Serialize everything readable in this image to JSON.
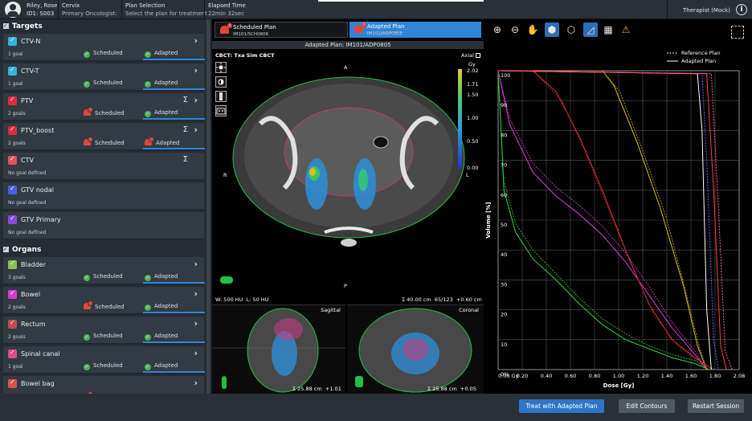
{
  "header": {
    "patient_name": "Riley, Rose",
    "id_label": "ID1:",
    "id_value": "S003",
    "site": "Cervix",
    "oncologist_label": "Primary Oncologist:",
    "plan_selection_label": "Plan Selection",
    "plan_selection_value": "Select the plan for treatment",
    "elapsed_label": "Elapsed Time",
    "elapsed_value": "22min 32sec",
    "role": "Therapist (Mock)",
    "info_icon": "info-icon"
  },
  "targets": {
    "title": "Targets",
    "items": [
      {
        "name": "CTV-N",
        "goals": "1 goal",
        "color": "#33b5e5",
        "scheduled": "Scheduled",
        "adapted": "Adapted",
        "sched_alert": false,
        "adapt_alert": false,
        "sigma": false,
        "chevron": true
      },
      {
        "name": "CTV-T",
        "goals": "1 goal",
        "color": "#33b5e5",
        "scheduled": "Scheduled",
        "adapted": "Adapted",
        "sched_alert": false,
        "adapt_alert": false,
        "sigma": false,
        "chevron": true
      },
      {
        "name": "PTV",
        "goals": "2 goals",
        "color": "#e02b3c",
        "scheduled": "Scheduled",
        "adapted": "Adapted",
        "sched_alert": true,
        "adapt_alert": false,
        "sigma": true,
        "chevron": true
      },
      {
        "name": "PTV_boost",
        "goals": "2 goals",
        "color": "#e02b3c",
        "scheduled": "Scheduled",
        "adapted": "Adapted",
        "sched_alert": true,
        "adapt_alert": true,
        "sigma": true,
        "chevron": true
      },
      {
        "name": "CTV",
        "goals": "No goal defined",
        "color": "#e85060",
        "scheduled": "",
        "adapted": "",
        "sched_alert": false,
        "adapt_alert": false,
        "sigma": true,
        "chevron": false
      },
      {
        "name": "GTV nodal",
        "goals": "No goal defined",
        "color": "#4b5fe0",
        "scheduled": "",
        "adapted": "",
        "sched_alert": false,
        "adapt_alert": false,
        "sigma": false,
        "chevron": false
      },
      {
        "name": "GTV Primary",
        "goals": "No goal defined",
        "color": "#8a4be0",
        "scheduled": "",
        "adapted": "",
        "sched_alert": false,
        "adapt_alert": false,
        "sigma": false,
        "chevron": false
      }
    ]
  },
  "organs": {
    "title": "Organs",
    "items": [
      {
        "name": "Bladder",
        "goals": "3 goals",
        "color": "#8bc34a",
        "scheduled": "Scheduled",
        "adapted": "Adapted",
        "sched_alert": false,
        "adapt_alert": false,
        "sigma": false,
        "chevron": true
      },
      {
        "name": "Bowel",
        "goals": "2 goals",
        "color": "#d63ad6",
        "scheduled": "Scheduled",
        "adapted": "Adapted",
        "sched_alert": true,
        "adapt_alert": false,
        "sigma": false,
        "chevron": true
      },
      {
        "name": "Rectum",
        "goals": "2 goals",
        "color": "#c0504d",
        "scheduled": "Scheduled",
        "adapted": "Adapted",
        "sched_alert": false,
        "adapt_alert": false,
        "sigma": false,
        "chevron": true
      },
      {
        "name": "Spinal canal",
        "goals": "1 goal",
        "color": "#e04b8a",
        "scheduled": "Scheduled",
        "adapted": "Adapted",
        "sched_alert": false,
        "adapt_alert": false,
        "sigma": false,
        "chevron": true
      },
      {
        "name": "Bowel bag",
        "goals": "",
        "color": "#d9534f",
        "scheduled": "",
        "adapted": "",
        "sched_alert": true,
        "adapt_alert": false,
        "sigma": false,
        "chevron": true
      }
    ]
  },
  "plans": {
    "scheduled": {
      "label": "Scheduled Plan",
      "id": "IM101/SCH0806"
    },
    "adapted": {
      "label": "Adapted Plan",
      "id": "IM101/ADP0805"
    }
  },
  "viewer": {
    "title": "Adapted Plan: IM101/ADP0805",
    "series": "CBCT: Txa Sim CBCT",
    "view_axial": "Axial",
    "orient_a": "A",
    "orient_p": "P",
    "orient_r": "R",
    "orient_l": "L",
    "window": "W: 500 HU",
    "level": "L: 50 HU",
    "thickness": "Σ 40.00 cm",
    "slice": "65/123",
    "offset": "+0.60 cm",
    "colorbar_unit": "Gy",
    "colorbar_ticks": [
      "2.02",
      "1.71",
      "1.50",
      "1.00",
      "0.50",
      "0.00"
    ],
    "sagittal": {
      "label": "Sagittal",
      "thickness": "Σ 25.88 cm",
      "offset": "+1.01 cm"
    },
    "coronal": {
      "label": "Coronal",
      "thickness": "Σ 25.88 cm",
      "offset": "+0.05 cm"
    }
  },
  "dvh_toolbar": [
    "zoom-in-icon",
    "zoom-out-icon",
    "pan-hand-icon",
    "shield-filled-icon",
    "shield-outline-icon",
    "dvh-chart-icon",
    "film-icon",
    "warning-doc-icon"
  ],
  "chart_data": {
    "type": "line",
    "xlabel": "Dose [Gy]",
    "ylabel": "Volume [%]",
    "xlim": [
      0,
      2.08
    ],
    "ylim": [
      0,
      100
    ],
    "x_ticks": [
      "0.00 Gy",
      "0.20",
      "0.40",
      "0.60",
      "0.80",
      "1.00",
      "1.20",
      "1.40",
      "1.60",
      "1.80",
      "2.08"
    ],
    "y_ticks": [
      "100",
      "90",
      "80",
      "70",
      "60",
      "50",
      "40",
      "30",
      "20",
      "10",
      "0%"
    ],
    "legend": [
      "Reference Plan",
      "Adapted Plan"
    ],
    "series": [
      {
        "color": "#2bdc3a",
        "x": [
          0,
          0.05,
          0.15,
          0.3,
          0.5,
          0.7,
          0.9,
          1.1,
          1.3,
          1.5,
          1.7,
          1.82
        ],
        "y": [
          100,
          60,
          46,
          37,
          30,
          22,
          15,
          10,
          7,
          4,
          2,
          0
        ]
      },
      {
        "color": "#20b030",
        "x": [
          0,
          0.05,
          0.15,
          0.3,
          0.5,
          0.7,
          0.9,
          1.1,
          1.3,
          1.5,
          1.7,
          1.82
        ],
        "y": [
          100,
          63,
          49,
          40,
          32,
          24,
          17,
          12,
          8,
          5,
          3,
          0
        ]
      },
      {
        "color": "#e23ce0",
        "x": [
          0,
          0.1,
          0.3,
          0.5,
          0.7,
          0.9,
          1.1,
          1.3,
          1.5,
          1.7,
          1.8
        ],
        "y": [
          100,
          82,
          66,
          58,
          52,
          45,
          36,
          25,
          14,
          5,
          0
        ]
      },
      {
        "color": "#c030c0",
        "x": [
          0,
          0.1,
          0.3,
          0.5,
          0.7,
          0.9,
          1.1,
          1.3,
          1.5,
          1.7,
          1.8
        ],
        "y": [
          100,
          84,
          69,
          61,
          55,
          48,
          39,
          28,
          16,
          6,
          0
        ]
      },
      {
        "color": "#d8c020",
        "x": [
          0,
          0.9,
          1.0,
          1.2,
          1.4,
          1.6,
          1.72,
          1.8
        ],
        "y": [
          100,
          100,
          95,
          76,
          54,
          28,
          8,
          0
        ]
      },
      {
        "color": "#a89010",
        "x": [
          0,
          0.9,
          1.05,
          1.25,
          1.45,
          1.62,
          1.74,
          1.8
        ],
        "y": [
          100,
          100,
          93,
          73,
          51,
          26,
          7,
          0
        ]
      },
      {
        "color": "#e03030",
        "x": [
          0,
          0.3,
          0.5,
          0.7,
          0.9,
          1.1,
          1.3,
          1.5,
          1.7,
          1.85
        ],
        "y": [
          100,
          100,
          93,
          78,
          60,
          40,
          22,
          10,
          4,
          0
        ]
      },
      {
        "color": "#a02a28",
        "x": [
          0,
          0.3,
          0.55,
          0.75,
          0.95,
          1.15,
          1.35,
          1.55,
          1.75,
          1.88
        ],
        "y": [
          100,
          100,
          90,
          73,
          54,
          35,
          18,
          8,
          2,
          0
        ]
      },
      {
        "color": "#ffffff",
        "x": [
          0,
          1.72,
          1.76,
          1.8,
          1.84
        ],
        "y": [
          100,
          99,
          80,
          20,
          0
        ]
      },
      {
        "color": "#6070ff",
        "x": [
          0,
          1.76,
          1.8,
          1.86,
          1.9
        ],
        "y": [
          100,
          99,
          70,
          10,
          0
        ]
      },
      {
        "color": "#ff4040",
        "x": [
          0,
          1.8,
          1.86,
          1.92,
          1.97
        ],
        "y": [
          100,
          99,
          60,
          8,
          0
        ]
      },
      {
        "color": "#ff60a0",
        "x": [
          0,
          1.84,
          1.9,
          1.96,
          2.02
        ],
        "y": [
          100,
          99,
          55,
          6,
          0
        ]
      }
    ]
  },
  "actions": {
    "treat": "Treat with Adapted Plan",
    "edit": "Edit Contours",
    "restart": "Restart Session"
  }
}
